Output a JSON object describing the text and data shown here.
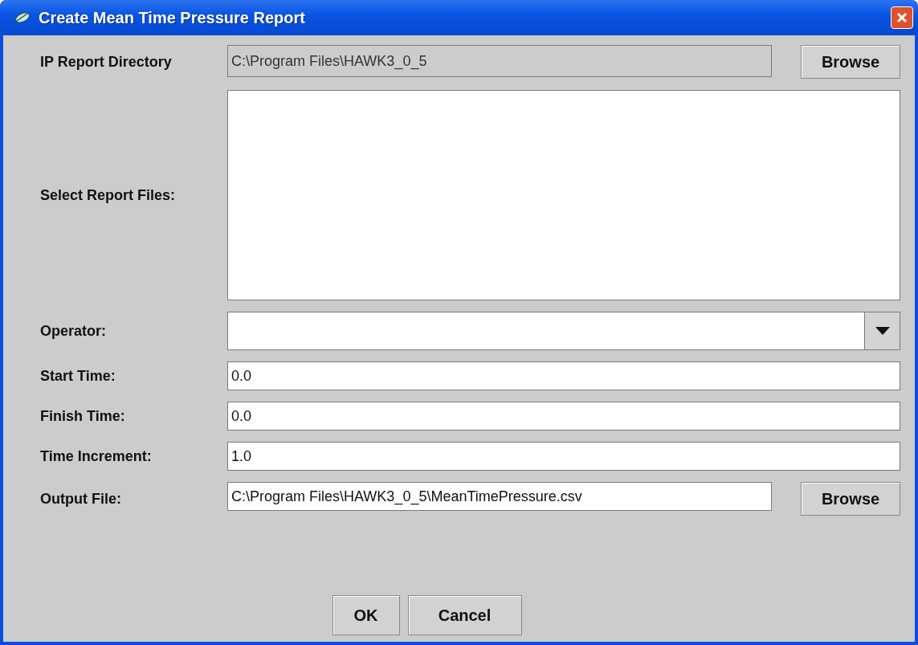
{
  "window": {
    "title": "Create Mean Time Pressure Report"
  },
  "rows": [
    {
      "kind": "text",
      "label": "IP Report Directory",
      "value": "C:\\Program Files\\HAWK3_0_5",
      "disabled": true,
      "button": "Browse"
    },
    {
      "kind": "list",
      "label": "Select Report Files:"
    },
    {
      "kind": "combo",
      "label": "Operator:"
    },
    {
      "kind": "text",
      "label": "Start Time:",
      "value": "0.0",
      "disabled": false
    },
    {
      "kind": "text",
      "label": "Finish Time:",
      "value": "0.0",
      "disabled": false
    },
    {
      "kind": "text",
      "label": "Time Increment:",
      "value": "1.0",
      "disabled": false
    },
    {
      "kind": "text",
      "label": "Output File:",
      "value": "C:\\Program Files\\HAWK3_0_5\\MeanTimePressure.csv",
      "disabled": false,
      "button": "Browse"
    }
  ],
  "buttons": [
    "OK",
    "Cancel"
  ]
}
